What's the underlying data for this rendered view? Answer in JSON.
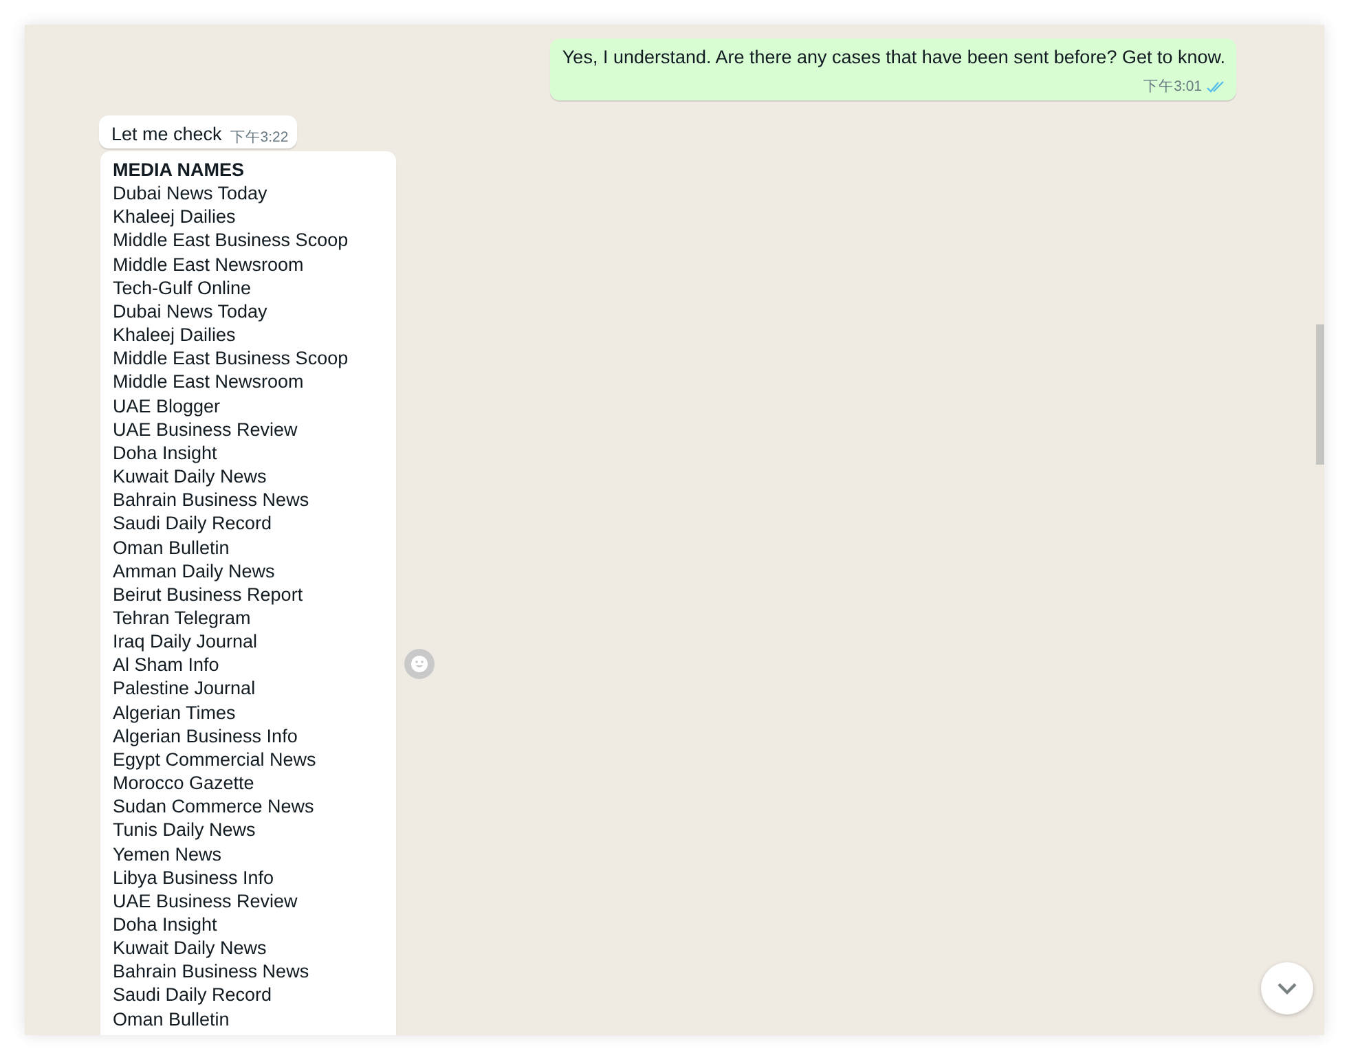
{
  "messages": [
    {
      "kind": "outgoing",
      "text": "Yes, I understand. Are there any cases that have been sent before? Get to know.",
      "time": "下午3:01",
      "read": true
    },
    {
      "kind": "incoming",
      "text": "Let me check",
      "time": "下午3:22"
    },
    {
      "kind": "list",
      "heading": "MEDIA NAMES",
      "items": [
        "Dubai News Today",
        "Khaleej Dailies",
        "Middle East Business Scoop",
        "Middle East Newsroom",
        "Tech-Gulf Online",
        "Dubai News Today",
        "Khaleej Dailies",
        "Middle East Business Scoop",
        "Middle East Newsroom",
        "UAE Blogger",
        "UAE Business Review",
        "Doha Insight",
        "Kuwait Daily News",
        "Bahrain Business News",
        "Saudi Daily Record",
        "Oman Bulletin",
        "Amman Daily News",
        "Beirut Business Report",
        "Tehran Telegram",
        "Iraq Daily Journal",
        "Al Sham Info",
        "Palestine Journal",
        "Algerian Times",
        "Algerian Business Info",
        "Egypt Commercial News",
        "Morocco Gazette",
        "Sudan Commerce News",
        "Tunis Daily News",
        "Yemen News",
        "Libya Business Info",
        "UAE Business Review",
        "Doha Insight",
        "Kuwait Daily News",
        "Bahrain Business News",
        "Saudi Daily Record",
        "Oman Bulletin"
      ]
    }
  ]
}
